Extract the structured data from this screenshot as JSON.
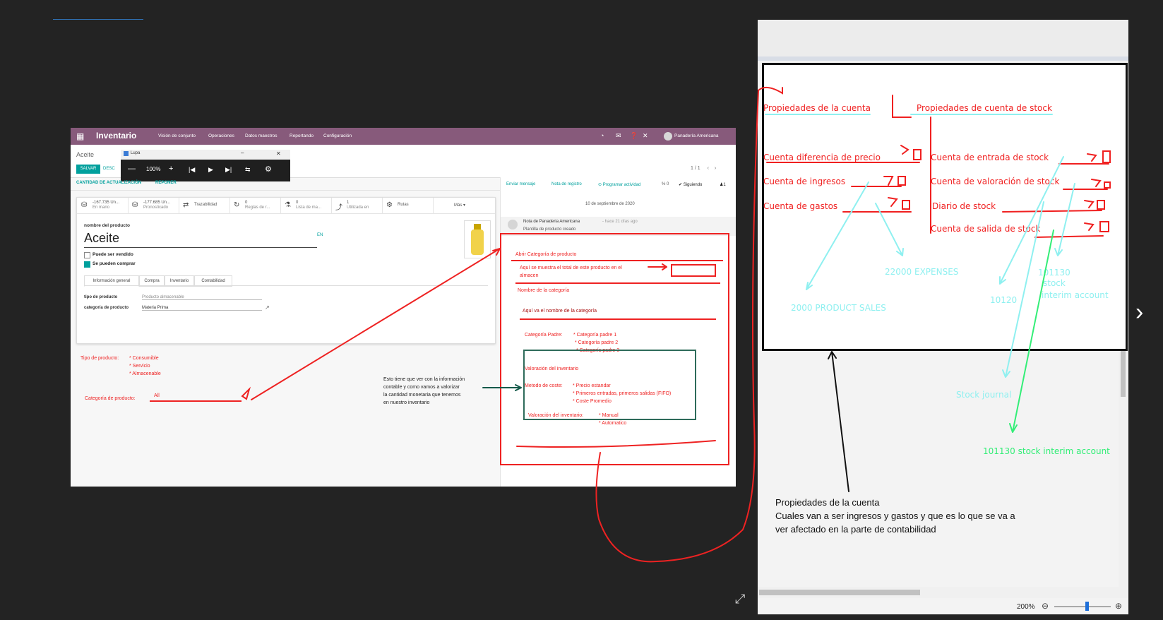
{
  "odoo": {
    "app_title": "Inventario",
    "menu": [
      "Visión de conjunto",
      "Operaciones",
      "Datos maestros",
      "Reportando",
      "Configuración"
    ],
    "user": "Panadería Americana",
    "breadcrumb": "Aceite",
    "save": "SALVAR",
    "discard": "DESC",
    "pager": "1 / 1",
    "update_qty": "CANTIDAD DE ACTUALIZACIÓN",
    "replenish": "REPONER",
    "smart_buttons": [
      {
        "l1": "-167.735 Un...",
        "l2": "En mano",
        "icon": "cubes-icon"
      },
      {
        "l1": "-177.685 Un...",
        "l2": "Pronosticado",
        "icon": "cubes-icon"
      },
      {
        "l1": "Trazabilidad",
        "l2": "",
        "icon": "exchange-icon"
      },
      {
        "l1": "0",
        "l2": "Reglas de r...",
        "icon": "refresh-icon"
      },
      {
        "l1": "0",
        "l2": "Lista de ma...",
        "icon": "flask-icon"
      },
      {
        "l1": "1",
        "l2": "Utilizada en",
        "icon": "level-up-icon"
      },
      {
        "l1": "Rutas",
        "l2": "",
        "icon": "cogs-icon"
      },
      {
        "l1": "Más ▾",
        "l2": "",
        "icon": ""
      }
    ],
    "product_label": "nombre del producto",
    "product_name": "Aceite",
    "lang": "EN",
    "can_sell": "Puede ser vendido",
    "can_buy": "Se pueden comprar",
    "tabs": [
      "Información general",
      "Compra",
      "Inventario",
      "Contabilidad"
    ],
    "type_label": "tipo de producto",
    "type_value": "Producto almacenable",
    "category_label": "categoría de producto",
    "category_value": "Materia Prima",
    "chatter": {
      "send": "Enviar mensaje",
      "note": "Nota de registro",
      "schedule": "⊙ Programar actividad",
      "att": "% 0",
      "following": "✔ Siguiendo",
      "followers": "♟1",
      "date": "10 de septiembre de 2020",
      "msg_author": "Nota de Panaderia Americana",
      "msg_time": "- hace 21 días ago",
      "msg_body": "Plantilla de producto creado"
    }
  },
  "magnifier": {
    "title": "Lupa",
    "zoom": "100%",
    "controls": [
      "—",
      "+",
      "|◀",
      "▶",
      "▶|",
      "⇆",
      "⚙"
    ]
  },
  "left_annotations": {
    "type_title": "Tipo de producto:",
    "type_items": [
      "* Consumible",
      "* Servicio",
      "* Almacenable"
    ],
    "category_title": "Categoría de producto:",
    "category_value": "All",
    "note": [
      "Esto tiene que ver con la información",
      "contable y como vamos a valorizar",
      "la cantidad monetaria que tenemos",
      "en nuestro inventario"
    ],
    "box_open": "Abrir Categoría de producto",
    "box_total": [
      "Aquí se muestra el total de este producto en el",
      "almacen"
    ],
    "box_name_label": "Nombre de la categoría",
    "box_name_value": "Aquí va el nombre de la categoría",
    "parent_label": "Categoría Padre:",
    "parents": [
      "* Categoría padre 1",
      "* Categoría padre 2",
      "* Categoría padre 3"
    ],
    "valuation_title": "Valoración del inventario",
    "cost_label": "Metodo de coste:",
    "cost_items": [
      "* Precio estandar",
      "* Primeros entradas, primeros salidas (FIFO)",
      "* Coste Promedio"
    ],
    "val_label": "Valoración del inventario:",
    "val_items": [
      "* Manual",
      "* Automatico"
    ]
  },
  "sketch": {
    "left_title": "Propiedades de la cuenta",
    "right_title": "Propiedades de cuenta de stock",
    "left_rows": [
      "Cuenta diferencia de precio",
      "Cuenta de ingresos",
      "Cuenta de gastos"
    ],
    "right_rows": [
      "Cuenta de entrada de stock",
      "Cuenta de valoración de stock",
      "Diario de stock",
      "Cuenta de salida de stock"
    ],
    "expenses": "22000 EXPENSES",
    "sales": "2000 PRODUCT SALES",
    "acc_10120": "10120",
    "interim_1": "101130",
    "interim_2": "stock",
    "interim_3": "interim account",
    "stock_journal": "Stock journal",
    "green_label": "101130 stock interim account"
  },
  "panel_note": [
    "Propiedades de la cuenta",
    "Cuales van a ser ingresos y gastos y que es lo que se va a",
    "ver afectado en la parte de contabilidad"
  ],
  "panel_zoom": "200%"
}
